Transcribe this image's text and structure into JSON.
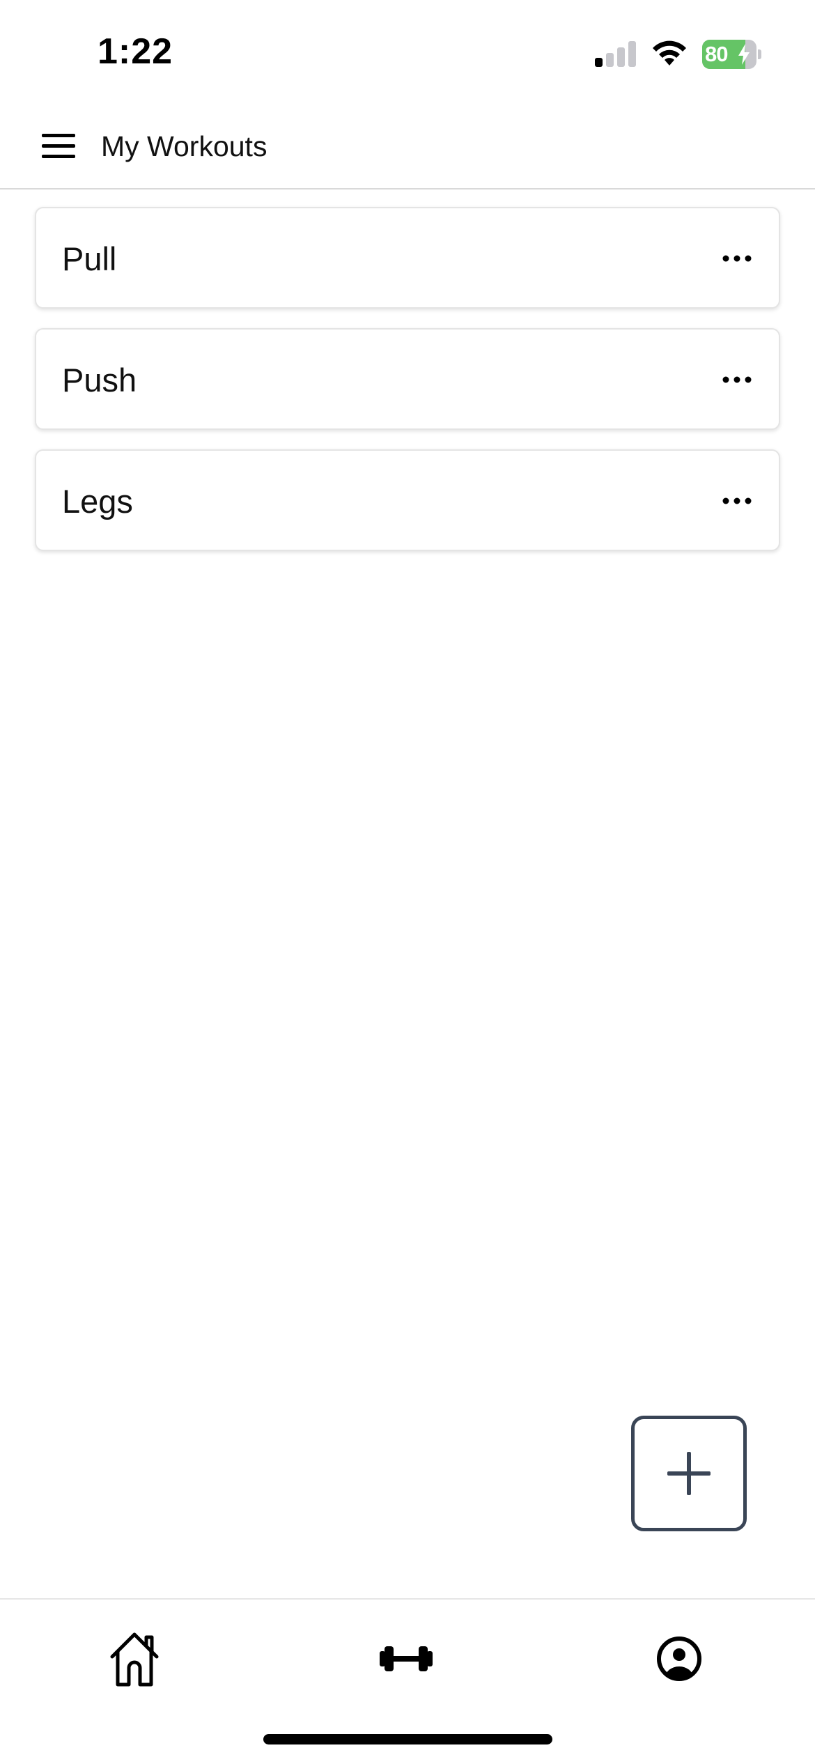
{
  "status_bar": {
    "time": "1:22",
    "battery_level": "80",
    "signal_bars_active": 1,
    "signal_bars_total": 4,
    "battery_charging": true,
    "battery_color": "#65c466"
  },
  "header": {
    "menu_icon": "hamburger-menu-icon",
    "title": "My Workouts"
  },
  "workouts": [
    {
      "name": "Pull",
      "menu_icon": "more-horizontal-icon"
    },
    {
      "name": "Push",
      "menu_icon": "more-horizontal-icon"
    },
    {
      "name": "Legs",
      "menu_icon": "more-horizontal-icon"
    }
  ],
  "fab": {
    "icon": "plus-icon",
    "color": "#3a4556"
  },
  "tab_bar": {
    "tabs": [
      {
        "icon": "home-icon"
      },
      {
        "icon": "dumbbell-icon"
      },
      {
        "icon": "user-circle-icon"
      }
    ]
  }
}
